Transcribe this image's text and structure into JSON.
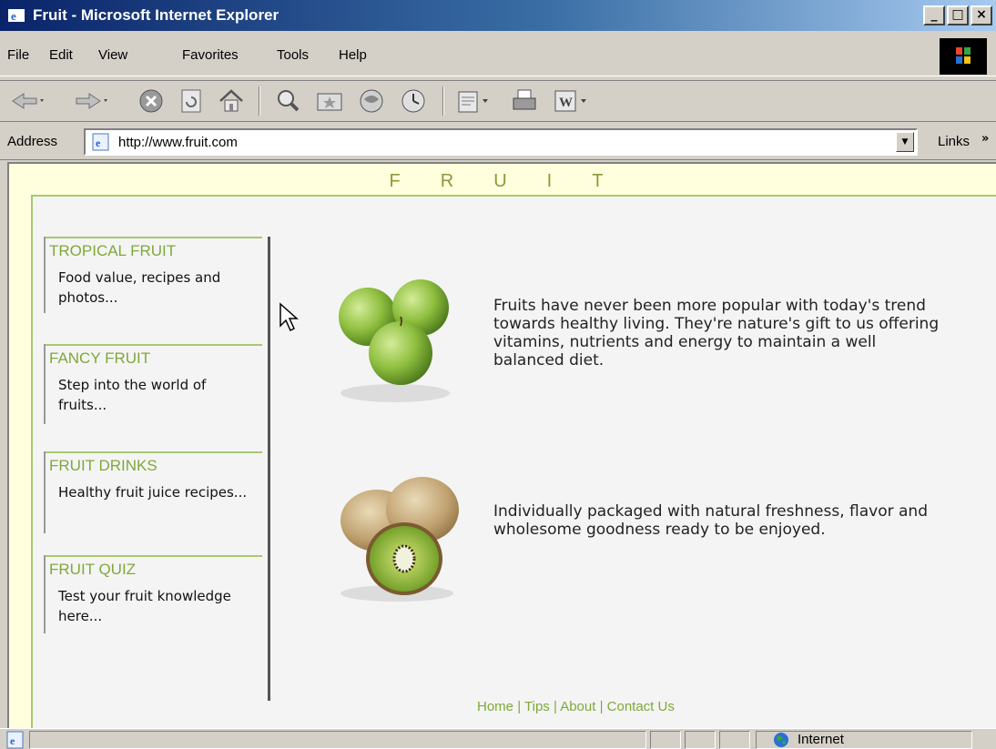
{
  "window": {
    "title": "Fruit - Microsoft Internet Explorer"
  },
  "menu": [
    "File",
    "Edit",
    "View",
    "Favorites",
    "Tools",
    "Help"
  ],
  "toolbar": {
    "icons": [
      "back-icon",
      "forward-icon",
      "stop-icon",
      "refresh-icon",
      "home-icon",
      "search-icon",
      "favorites-icon",
      "media-icon",
      "history-icon",
      "mail-icon",
      "print-icon",
      "edit-icon"
    ]
  },
  "address": {
    "label": "Address",
    "url": "http://www.fruit.com",
    "links_label": "Links"
  },
  "page": {
    "site_title": "FRUIT",
    "nav": [
      {
        "title": "TROPICAL FRUIT",
        "desc": "Food value, recipes and photos..."
      },
      {
        "title": "FANCY FRUIT",
        "desc": "Step into the world of fruits..."
      },
      {
        "title": "FRUIT DRINKS",
        "desc": "Healthy fruit juice recipes..."
      },
      {
        "title": "FRUIT QUIZ",
        "desc": "Test your fruit knowledge here..."
      }
    ],
    "paragraphs": [
      "Fruits have never been more popular with today's trend towards healthy living. They're nature's gift to us offering vitamins, nutrients and energy to maintain a well balanced diet.",
      "Individually packaged with natural freshness, flavor and wholesome goodness ready to be enjoyed."
    ],
    "footer": {
      "home": "Home",
      "tips": "Tips",
      "about": "About",
      "contact": "Contact Us",
      "sep": "|"
    }
  },
  "status": {
    "zone": "Internet"
  },
  "colors": {
    "accent": "#7fa83a",
    "page_bg": "#ffffdd",
    "content_bg": "#f4f4f4",
    "titlebar": "#0a246a"
  }
}
